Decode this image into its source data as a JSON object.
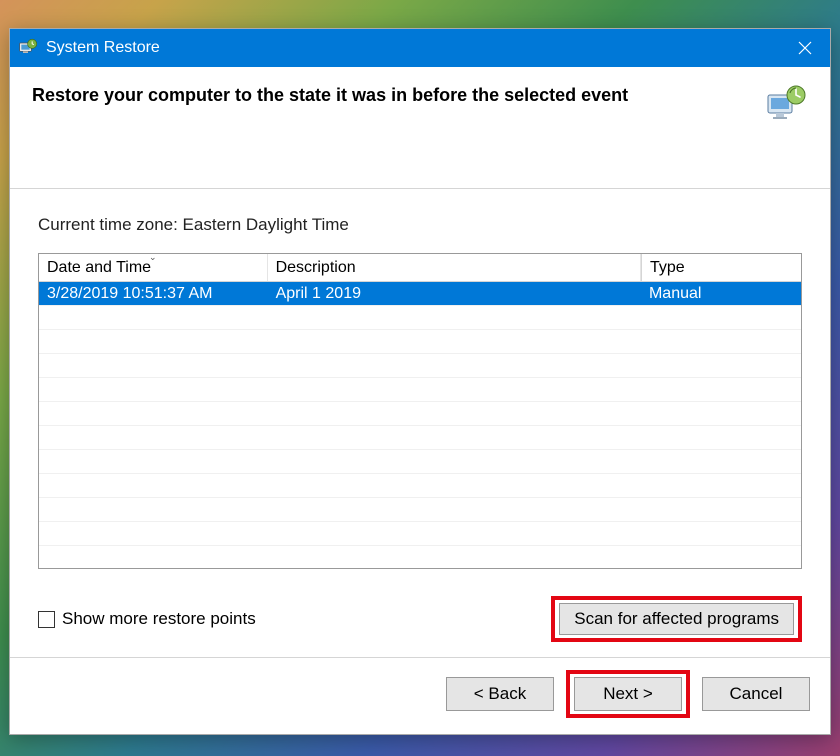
{
  "titlebar": {
    "title": "System Restore"
  },
  "header": {
    "heading": "Restore your computer to the state it was in before the selected event"
  },
  "timezone": {
    "label": "Current time zone: Eastern Daylight Time"
  },
  "table": {
    "columns": {
      "date": "Date and Time",
      "description": "Description",
      "type": "Type"
    },
    "rows": [
      {
        "date": "3/28/2019 10:51:37 AM",
        "description": "April 1 2019",
        "type": "Manual",
        "selected": true
      }
    ]
  },
  "checkbox": {
    "label": "Show more restore points",
    "checked": false
  },
  "scan": {
    "label": "Scan for affected programs"
  },
  "footer": {
    "back": "< Back",
    "next": "Next >",
    "cancel": "Cancel"
  }
}
